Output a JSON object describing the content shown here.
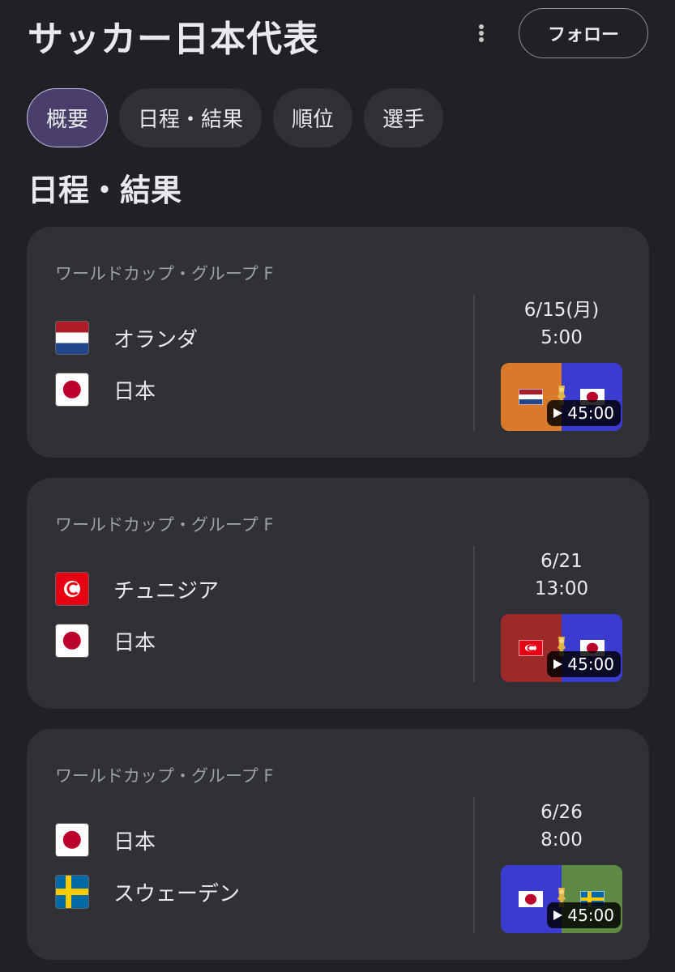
{
  "header": {
    "title": "サッカー日本代表",
    "follow_label": "フォロー"
  },
  "tabs": [
    {
      "label": "概要",
      "active": true
    },
    {
      "label": "日程・結果",
      "active": false
    },
    {
      "label": "順位",
      "active": false
    },
    {
      "label": "選手",
      "active": false
    }
  ],
  "section_title": "日程・結果",
  "matches": [
    {
      "league": "ワールドカップ・グループ F",
      "home": {
        "name": "オランダ",
        "flag": "netherlands-flag"
      },
      "away": {
        "name": "日本",
        "flag": "japan-flag"
      },
      "date": "6/15(月)",
      "time": "5:00",
      "video_duration": "45:00",
      "thumb_colors": [
        "#d97a2b",
        "#3b3bd0"
      ]
    },
    {
      "league": "ワールドカップ・グループ F",
      "home": {
        "name": "チュニジア",
        "flag": "tunisia-flag"
      },
      "away": {
        "name": "日本",
        "flag": "japan-flag"
      },
      "date": "6/21",
      "time": "13:00",
      "video_duration": "45:00",
      "thumb_colors": [
        "#9c2a2a",
        "#3b3bd0"
      ]
    },
    {
      "league": "ワールドカップ・グループ F",
      "home": {
        "name": "日本",
        "flag": "japan-flag"
      },
      "away": {
        "name": "スウェーデン",
        "flag": "sweden-flag"
      },
      "date": "6/26",
      "time": "8:00",
      "video_duration": "45:00",
      "thumb_colors": [
        "#3b3bd0",
        "#5e8a44"
      ]
    }
  ]
}
